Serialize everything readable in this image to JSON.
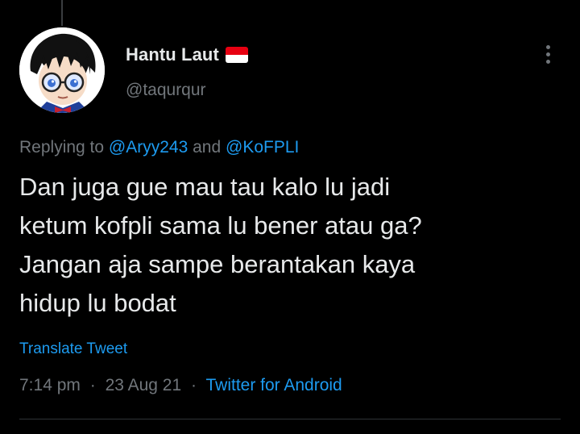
{
  "tweet": {
    "author": {
      "display_name": "Hantu Laut",
      "handle": "@taqurqur",
      "flag_icon": "indonesia-flag-icon",
      "avatar_icon": "cartoon-avatar"
    },
    "more_icon": "vertical-dots-icon",
    "replying": {
      "prefix": "Replying to",
      "mention_1": "@Aryy243",
      "conjunction": "and",
      "mention_2": "@KoFPLI"
    },
    "text_lines": [
      "Dan juga gue mau tau kalo lu jadi",
      "ketum kofpli sama lu bener atau ga?",
      "Jangan aja sampe berantakan kaya",
      "hidup lu bodat"
    ],
    "translate_label": "Translate Tweet",
    "time": "7:14 pm",
    "date": "23 Aug 21",
    "separator": "·",
    "source": "Twitter for Android"
  },
  "colors": {
    "background": "#000000",
    "text": "#e7e9ea",
    "muted": "#71767b",
    "accent": "#1d9bf0",
    "divider": "#2f3336"
  }
}
